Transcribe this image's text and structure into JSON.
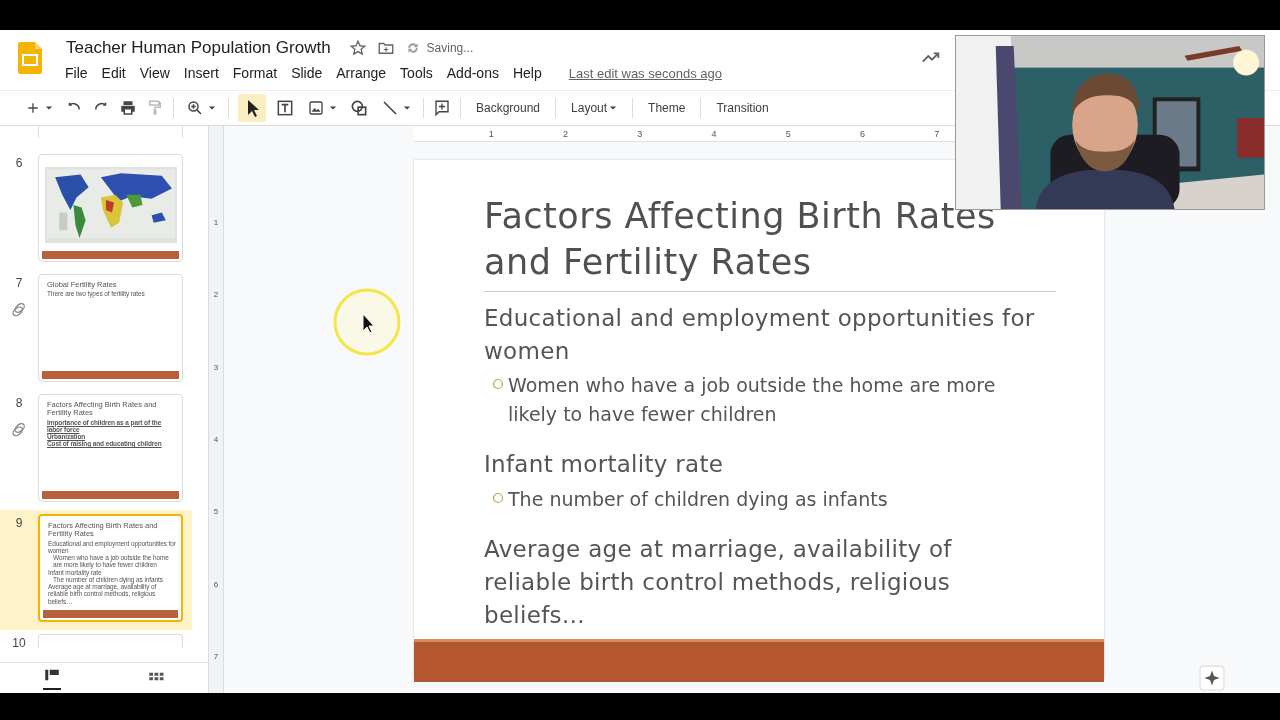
{
  "document": {
    "title": "Teacher Human Population Growth",
    "save_status": "Saving...",
    "last_edit": "Last edit was seconds ago"
  },
  "menu": [
    "File",
    "Edit",
    "View",
    "Insert",
    "Format",
    "Slide",
    "Arrange",
    "Tools",
    "Add-ons",
    "Help"
  ],
  "toolbar": {
    "buttons": [
      {
        "label": "Background",
        "kind": "plain"
      },
      {
        "label": "Layout",
        "kind": "dropdown"
      },
      {
        "label": "Theme",
        "kind": "plain"
      },
      {
        "label": "Transition",
        "kind": "plain"
      }
    ]
  },
  "ruler": {
    "labels": [
      "1",
      "2",
      "3",
      "4",
      "5",
      "6",
      "7"
    ]
  },
  "vertical_ruler": {
    "labels": [
      "1",
      "2",
      "3",
      "4",
      "5",
      "6",
      "7"
    ]
  },
  "filmstrip": {
    "slides": [
      {
        "number": "6",
        "kind": "picture",
        "linked": false,
        "selected": false
      },
      {
        "number": "7",
        "kind": "text",
        "linked": true,
        "selected": false,
        "title": "Global Fertility Rates",
        "lines": [
          {
            "text": "There are two types of fertility rates",
            "kind": "body"
          }
        ]
      },
      {
        "number": "8",
        "kind": "text",
        "linked": true,
        "selected": false,
        "title": "Factors Affecting Birth Rates and Fertility Rates",
        "lines": [
          {
            "text": "Importance of children as a part of the labor force",
            "kind": "heading"
          },
          {
            "text": "Urbanization",
            "kind": "heading"
          },
          {
            "text": "Cost of raising and educating children",
            "kind": "heading"
          }
        ]
      },
      {
        "number": "9",
        "kind": "text",
        "linked": false,
        "selected": true,
        "title": "Factors Affecting Birth Rates and Fertility Rates",
        "lines": [
          {
            "text": "Educational and employment opportunities for women",
            "kind": "body"
          },
          {
            "text": "Women who have a job outside the home are more likely to have fewer children",
            "kind": "sub"
          },
          {
            "text": "Infant mortality rate",
            "kind": "body"
          },
          {
            "text": "The number of children dying as infants",
            "kind": "sub"
          },
          {
            "text": "Average age at marriage, availability of reliable birth control methods, religious beliefs…",
            "kind": "body"
          }
        ]
      },
      {
        "number": "10",
        "kind": "partial",
        "linked": false,
        "selected": false
      }
    ]
  },
  "slide": {
    "title": "Factors Affecting Birth Rates and Fertility Rates",
    "items": [
      {
        "kind": "heading",
        "text": "Educational and employment opportunities for women"
      },
      {
        "kind": "bullet",
        "text": "Women who have a job outside the home are more likely to have fewer children"
      },
      {
        "kind": "heading",
        "text": "Infant mortality rate"
      },
      {
        "kind": "bullet",
        "text": "The number of children dying as infants"
      },
      {
        "kind": "heading",
        "text": "Average age at marriage, availability of reliable birth control methods, religious beliefs…"
      }
    ]
  }
}
